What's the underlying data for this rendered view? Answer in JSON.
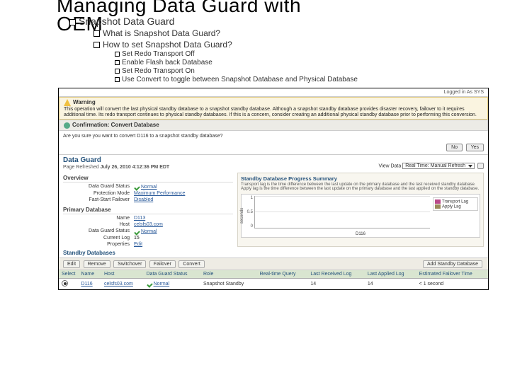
{
  "slide": {
    "title_l1": "Managing Data Guard with",
    "title_l2": "OEM",
    "b1": "Snapshot Data Guard",
    "b2a": "What is Snapshot Data Guard?",
    "b2b": "How to set Snapshot Data Guard?",
    "b3a": "Set Redo Transport Off",
    "b3b": "Enable Flash back Database",
    "b3c": "Set Redo Transport On",
    "b3d": "Use Convert to toggle between Snapshot Database and Physical Database"
  },
  "oem": {
    "logged_in": "Logged in As SYS",
    "warning_label": "Warning",
    "warning_text": "This operation will convert the last physical standby database to a snapshot standby database. Although a snapshot standby database provides disaster recovery, failover to it requires additional time. Its redo transport continues to physical standby databases. If this is a concern, consider creating an additional physical standby database prior to performing this conversion.",
    "confirm_title": "Confirmation: Convert Database",
    "confirm_q": "Are you sure you want to convert D116 to a snapshot standby database?",
    "btn_no": "No",
    "btn_yes": "Yes",
    "dg_title": "Data Guard",
    "refresh_label": "Page Refreshed",
    "refresh_time": "July 26, 2010 4:12:36 PM EDT",
    "view_data_label": "View Data",
    "view_data_value": "Real Time: Manual Refresh",
    "overview": {
      "head": "Overview",
      "status_k": "Data Guard Status",
      "status_v": "Normal",
      "prot_k": "Protection Mode",
      "prot_v": "Maximum Performance",
      "fsf_k": "Fast-Start Failover",
      "fsf_v": "Disabled"
    },
    "primary": {
      "head": "Primary Database",
      "name_k": "Name",
      "name_v": "D113",
      "host_k": "Host",
      "host_v": "celsfs03.com",
      "dgs_k": "Data Guard Status",
      "dgs_v": "Normal",
      "cur_k": "Current Log",
      "cur_v": "15",
      "prop_k": "Properties",
      "prop_v": "Edit"
    },
    "summary": {
      "title": "Standby Database Progress Summary",
      "desc": "Transport lag is the time difference between the last update on the primary database and the last received standby database. Apply lag is the time difference between the last update on the primary database and the last applied on the standby database."
    },
    "standby_title": "Standby Databases",
    "actions": {
      "edit": "Edit",
      "remove": "Remove",
      "switchover": "Switchover",
      "failover": "Failover",
      "convert": "Convert",
      "add": "Add Standby Database"
    },
    "table": {
      "cols": {
        "select": "Select",
        "name": "Name",
        "host": "Host",
        "status": "Data Guard Status",
        "role": "Role",
        "rtq": "Real-time Query",
        "lrl": "Last Received Log",
        "lal": "Last Applied Log",
        "eft": "Estimated Failover Time"
      },
      "rows": [
        {
          "name": "D116",
          "host": "celsfs03.com",
          "status": "Normal",
          "role": "Snapshot Standby",
          "rtq": " ",
          "lrl": "14",
          "lal": "14",
          "eft": "< 1 second"
        }
      ]
    }
  },
  "chart_data": {
    "type": "bar",
    "title": "",
    "xlabel": "",
    "ylabel": "seconds",
    "ylim": [
      0,
      1.0
    ],
    "yticks": [
      0.0,
      0.5,
      1.0
    ],
    "categories": [
      "D116"
    ],
    "series": [
      {
        "name": "Transport Lag",
        "color": "#b94a8a",
        "values": [
          0
        ]
      },
      {
        "name": "Apply Lag",
        "color": "#9a8a5a",
        "values": [
          0
        ]
      }
    ]
  }
}
